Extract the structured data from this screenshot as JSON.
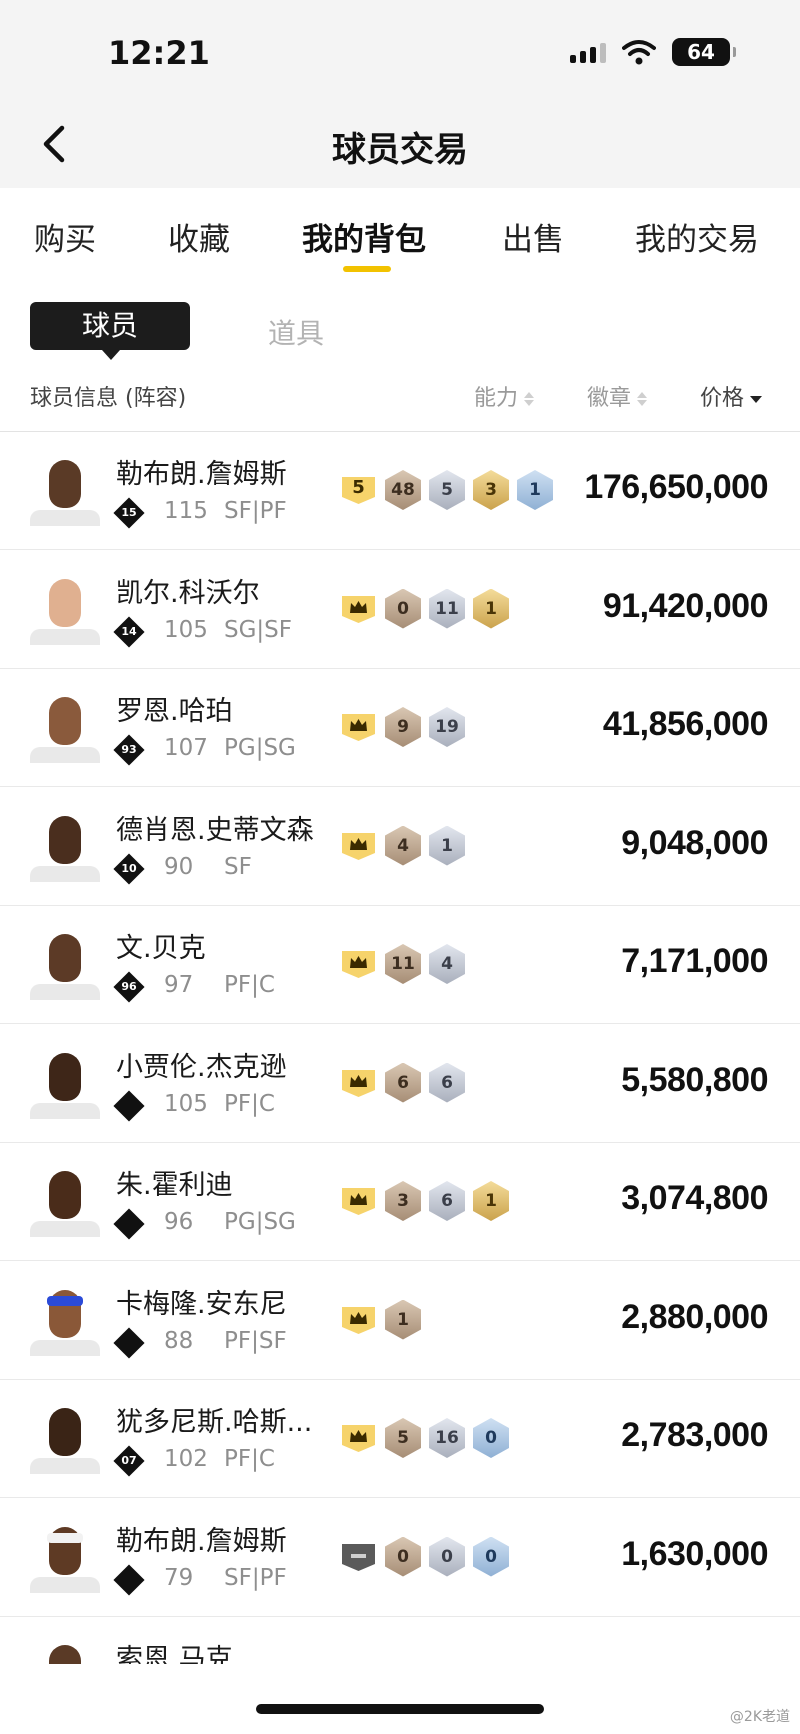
{
  "status": {
    "time": "12:21",
    "battery": "64"
  },
  "header": {
    "title": "球员交易",
    "back_icon": "chevron-left-icon"
  },
  "tabs": [
    {
      "label": "购买"
    },
    {
      "label": "收藏"
    },
    {
      "label": "我的背包",
      "active": true
    },
    {
      "label": "出售"
    },
    {
      "label": "我的交易"
    }
  ],
  "subtabs": {
    "players": "球员",
    "items": "道具"
  },
  "columns": {
    "info": "球员信息 (阵容)",
    "ability": "能力",
    "badges": "徽章",
    "price": "价格"
  },
  "colors": {
    "accent": "#f2c200",
    "crown": "#f6d36b"
  },
  "players": [
    {
      "name": "勒布朗.詹姆斯",
      "tier": "15",
      "ovr": "115",
      "pos": "SF|PF",
      "price": "176,650,000",
      "level": "5",
      "badges": [
        {
          "t": "bronze",
          "v": "48"
        },
        {
          "t": "silver",
          "v": "5"
        },
        {
          "t": "gold",
          "v": "3"
        },
        {
          "t": "hof",
          "v": "1"
        }
      ]
    },
    {
      "name": "凯尔.科沃尔",
      "tier": "14",
      "ovr": "105",
      "pos": "SG|SF",
      "price": "91,420,000",
      "level": "",
      "badges": [
        {
          "t": "bronze",
          "v": "0"
        },
        {
          "t": "silver",
          "v": "11"
        },
        {
          "t": "gold",
          "v": "1"
        }
      ]
    },
    {
      "name": "罗恩.哈珀",
      "tier": "93",
      "ovr": "107",
      "pos": "PG|SG",
      "price": "41,856,000",
      "level": "",
      "badges": [
        {
          "t": "bronze",
          "v": "9"
        },
        {
          "t": "silver",
          "v": "19"
        }
      ]
    },
    {
      "name": "德肖恩.史蒂文森",
      "tier": "10",
      "ovr": "90",
      "pos": "SF",
      "price": "9,048,000",
      "level": "",
      "badges": [
        {
          "t": "bronze",
          "v": "4"
        },
        {
          "t": "silver",
          "v": "1"
        }
      ]
    },
    {
      "name": "文.贝克",
      "tier": "96",
      "ovr": "97",
      "pos": "PF|C",
      "price": "7,171,000",
      "level": "",
      "badges": [
        {
          "t": "bronze",
          "v": "11"
        },
        {
          "t": "silver",
          "v": "4"
        }
      ]
    },
    {
      "name": "小贾伦.杰克逊",
      "tier": "",
      "ovr": "105",
      "pos": "PF|C",
      "price": "5,580,800",
      "level": "",
      "badges": [
        {
          "t": "bronze",
          "v": "6"
        },
        {
          "t": "silver",
          "v": "6"
        }
      ]
    },
    {
      "name": "朱.霍利迪",
      "tier": "",
      "ovr": "96",
      "pos": "PG|SG",
      "price": "3,074,800",
      "level": "",
      "badges": [
        {
          "t": "bronze",
          "v": "3"
        },
        {
          "t": "silver",
          "v": "6"
        },
        {
          "t": "gold",
          "v": "1"
        }
      ]
    },
    {
      "name": "卡梅隆.安东尼",
      "tier": "",
      "ovr": "88",
      "pos": "PF|SF",
      "price": "2,880,000",
      "level": "",
      "badges": [
        {
          "t": "bronze",
          "v": "1"
        }
      ]
    },
    {
      "name": "犹多尼斯.哈斯...",
      "tier": "07",
      "ovr": "102",
      "pos": "PF|C",
      "price": "2,783,000",
      "level": "",
      "badges": [
        {
          "t": "bronze",
          "v": "5"
        },
        {
          "t": "silver",
          "v": "16"
        },
        {
          "t": "hof",
          "v": "0"
        }
      ]
    },
    {
      "name": "勒布朗.詹姆斯",
      "tier": "",
      "ovr": "79",
      "pos": "SF|PF",
      "price": "1,630,000",
      "level": "none",
      "badges": [
        {
          "t": "bronze",
          "v": "0"
        },
        {
          "t": "silver",
          "v": "0"
        },
        {
          "t": "hof",
          "v": "0"
        }
      ]
    },
    {
      "name": "索恩.马克",
      "tier": "",
      "ovr": "",
      "pos": "",
      "price": "",
      "level": "",
      "badges": []
    }
  ],
  "watermark": "@2K老道"
}
